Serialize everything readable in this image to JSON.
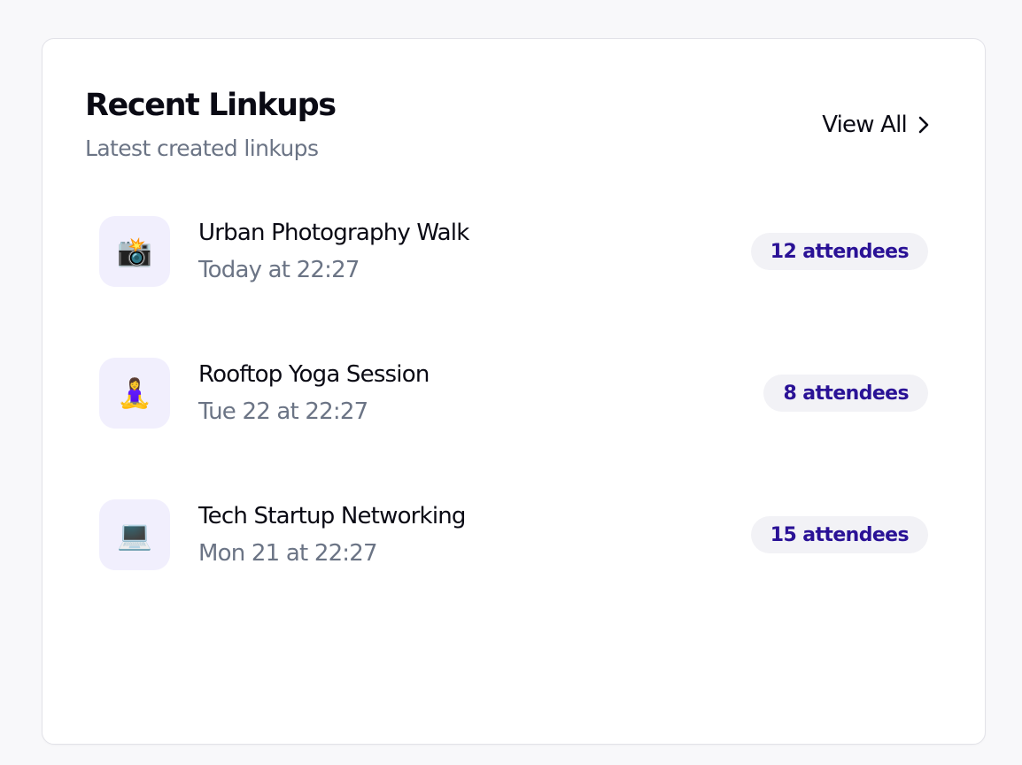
{
  "card": {
    "title": "Recent Linkups",
    "subtitle": "Latest created linkups",
    "view_all_label": "View All"
  },
  "linkups": [
    {
      "icon": "📸",
      "icon_name": "camera-flash-icon",
      "title": "Urban Photography Walk",
      "time": "Today at 22:27",
      "attendees": "12 attendees"
    },
    {
      "icon": "🧘‍♀️",
      "icon_name": "yoga-person-icon",
      "title": "Rooftop Yoga Session",
      "time": "Tue 22 at 22:27",
      "attendees": "8 attendees"
    },
    {
      "icon": "💻",
      "icon_name": "laptop-icon",
      "title": "Tech Startup Networking",
      "time": "Mon 21 at 22:27",
      "attendees": "15 attendees"
    }
  ],
  "colors": {
    "badge_text": "#2a1296",
    "icon_bg": "#f1effd",
    "muted_text": "#6b7485"
  }
}
